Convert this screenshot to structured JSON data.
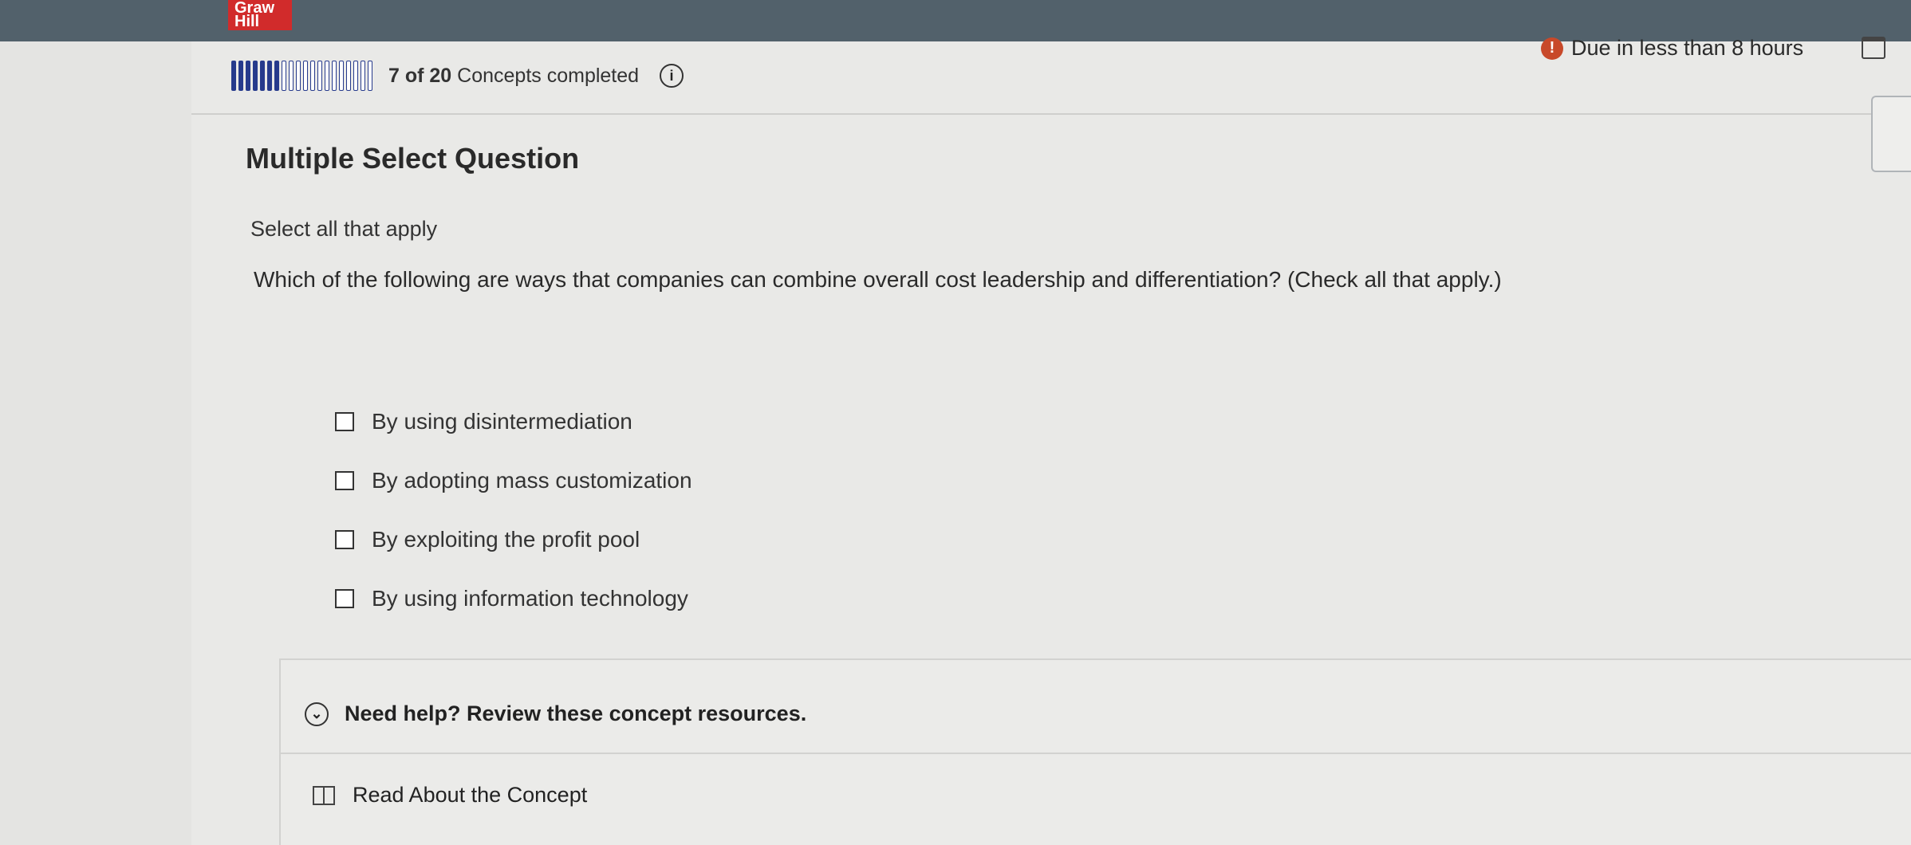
{
  "brand": {
    "logo_line1": "Graw",
    "logo_line2": "Hill"
  },
  "progress": {
    "completed": 7,
    "total": 20,
    "count_text": "7 of 20",
    "label": "Concepts completed"
  },
  "due": {
    "alert_glyph": "!",
    "text": "Due in less than 8 hours"
  },
  "question": {
    "type_title": "Multiple Select Question",
    "instruction": "Select all that apply",
    "prompt": "Which of the following are ways that companies can combine overall cost leadership and differentiation? (Check all that apply.)",
    "options": [
      {
        "label": "By using disintermediation",
        "checked": false
      },
      {
        "label": "By adopting mass customization",
        "checked": false
      },
      {
        "label": "By exploiting the profit pool",
        "checked": false
      },
      {
        "label": "By using information technology",
        "checked": false
      }
    ]
  },
  "help": {
    "toggle_label": "Need help? Review these concept resources.",
    "resource_label": "Read About the Concept"
  },
  "icons": {
    "info": "info-icon",
    "alert": "alert-icon",
    "calendar": "calendar-icon",
    "chevron": "chevron-down-icon",
    "book": "book-icon"
  },
  "colors": {
    "progress": "#263a8c",
    "alert": "#c8492a",
    "brand": "#d12b2b"
  }
}
